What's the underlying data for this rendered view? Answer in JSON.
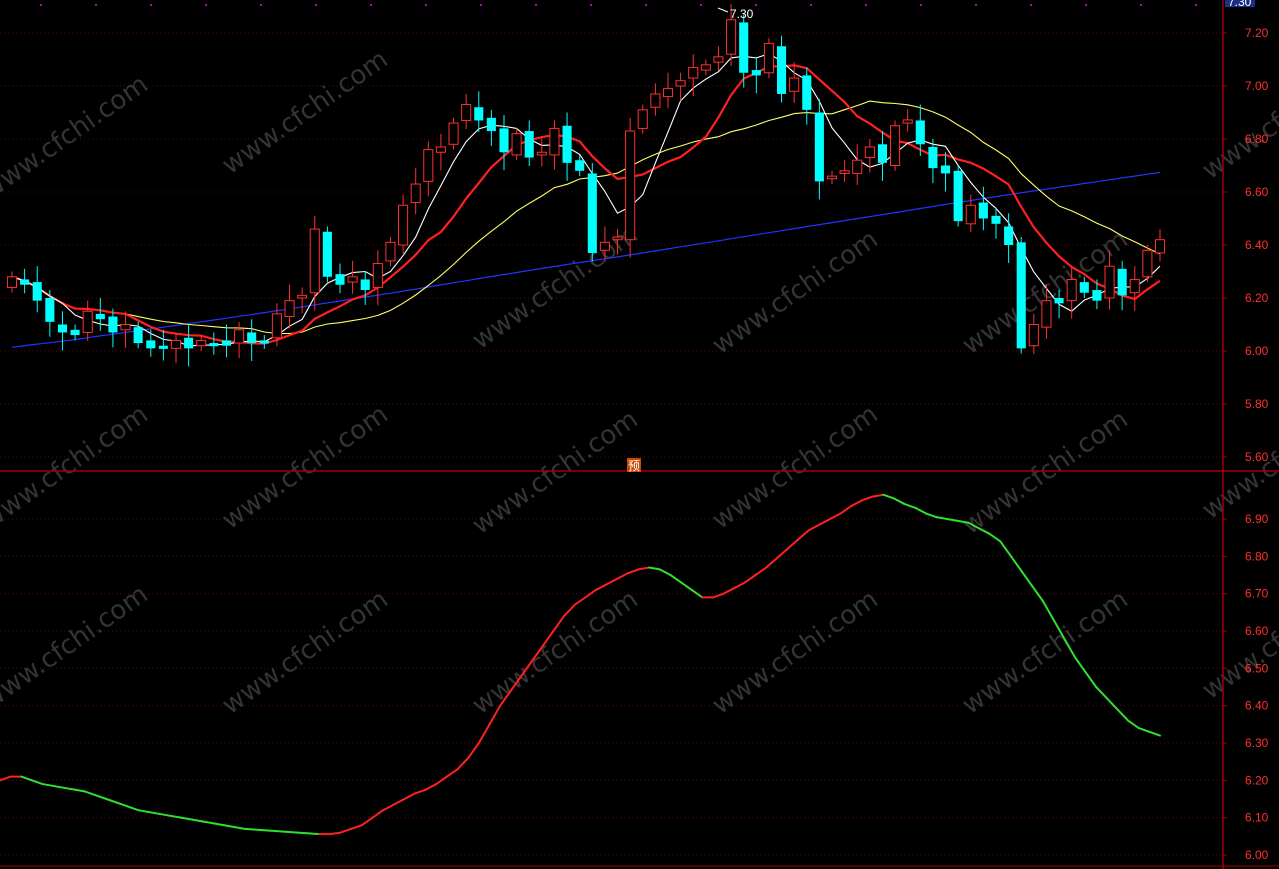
{
  "colors": {
    "background": "#000000",
    "frame": "#a00000",
    "grid": "#700000",
    "axis_text": "#ff3030",
    "candle_up": "#ff3030",
    "candle_down": "#00ffff",
    "ma_fast": "#ffffff",
    "ma_mid": "#ff2020",
    "ma_slow": "#ffff66",
    "ma_long": "#2233ff",
    "ind_up": "#ff2020",
    "ind_down": "#30e030",
    "top_label_bg": "#1a2f8a",
    "badge_bg": "#c84a00",
    "watermark": "#343434"
  },
  "watermark_text": "www.cfchi.com",
  "top_price_label": "7.30",
  "high_marker_label": "7.30",
  "prediction_badge": "预",
  "chart_data": [
    {
      "type": "candlestick",
      "panel": "price",
      "ylim": [
        5.55,
        7.3
      ],
      "y_ticks": [
        "7.20",
        "7.00",
        "6.80",
        "6.60",
        "6.40",
        "6.20",
        "6.00",
        "5.80",
        "5.60"
      ],
      "grid": true,
      "x": [
        1,
        2,
        3,
        4,
        5,
        6,
        7,
        8,
        9,
        10,
        11,
        12,
        13,
        14,
        15,
        16,
        17,
        18,
        19,
        20,
        21,
        22,
        23,
        24,
        25,
        26,
        27,
        28,
        29,
        30,
        31,
        32,
        33,
        34,
        35,
        36,
        37,
        38,
        39,
        40,
        41,
        42,
        43,
        44,
        45,
        46,
        47,
        48,
        49,
        50,
        51,
        52,
        53,
        54,
        55,
        56,
        57,
        58,
        59,
        60,
        61,
        62,
        63,
        64,
        65,
        66,
        67,
        68,
        69,
        70,
        71,
        72,
        73,
        74,
        75,
        76,
        77,
        78,
        79,
        80,
        81,
        82,
        83,
        84,
        85,
        86,
        87,
        88,
        89,
        90,
        91,
        92,
        93,
        94,
        95,
        96,
        97,
        98,
        99,
        100,
        101,
        102,
        103,
        104,
        105,
        106
      ],
      "open": [
        6.24,
        6.27,
        6.26,
        6.2,
        6.1,
        6.08,
        6.07,
        6.14,
        6.13,
        6.08,
        6.09,
        6.04,
        6.02,
        6.01,
        6.05,
        6.02,
        6.03,
        6.04,
        6.03,
        6.07,
        6.04,
        6.05,
        6.13,
        6.2,
        6.22,
        6.45,
        6.29,
        6.26,
        6.27,
        6.24,
        6.34,
        6.4,
        6.56,
        6.64,
        6.75,
        6.78,
        6.87,
        6.92,
        6.88,
        6.84,
        6.74,
        6.83,
        6.74,
        6.74,
        6.85,
        6.72,
        6.67,
        6.38,
        6.42,
        6.42,
        6.84,
        6.92,
        6.96,
        7.0,
        7.03,
        7.06,
        7.09,
        7.12,
        7.24,
        7.06,
        7.05,
        7.15,
        6.98,
        7.04,
        6.9,
        6.65,
        6.67,
        6.67,
        6.73,
        6.78,
        6.7,
        6.86,
        6.87,
        6.77,
        6.7,
        6.68,
        6.48,
        6.56,
        6.51,
        6.47,
        6.41,
        6.02,
        6.09,
        6.2,
        6.19,
        6.26,
        6.23,
        6.2,
        6.31,
        6.22,
        6.28,
        6.37
      ]
    },
    {
      "type": "line",
      "panel": "indicator",
      "ylim": [
        5.98,
        6.99
      ],
      "y_ticks": [
        "6.90",
        "6.80",
        "6.70",
        "6.60",
        "6.50",
        "6.40",
        "6.30",
        "6.20",
        "6.10",
        "6.00"
      ],
      "grid": true,
      "x": [
        0,
        1,
        2,
        3,
        4,
        5,
        6,
        7,
        8,
        9,
        10,
        11,
        12,
        13,
        14,
        15,
        16,
        17,
        18,
        19,
        20,
        21,
        22,
        23,
        24,
        25,
        26,
        27,
        28,
        29,
        30,
        31,
        32,
        33,
        34,
        35,
        36,
        37,
        38,
        39,
        40,
        41,
        42,
        43,
        44,
        45,
        46,
        47,
        48,
        49,
        50,
        51,
        52,
        53,
        54,
        55,
        56,
        57,
        58,
        59,
        60,
        61,
        62,
        63,
        64,
        65,
        66,
        67,
        68,
        69,
        70,
        71,
        72,
        73,
        74,
        75,
        76,
        77,
        78,
        79,
        80,
        81,
        82,
        83,
        84,
        85,
        86,
        87,
        88,
        89,
        90,
        91,
        92,
        93,
        94,
        95,
        96
      ],
      "values": [
        6.2,
        6.21,
        6.21,
        6.2,
        6.19,
        6.185,
        6.18,
        6.175,
        6.17,
        6.16,
        6.15,
        6.14,
        6.13,
        6.12,
        6.115,
        6.11,
        6.105,
        6.1,
        6.095,
        6.09,
        6.085,
        6.08,
        6.075,
        6.07,
        6.068,
        6.066,
        6.064,
        6.062,
        6.06,
        6.058,
        6.056,
        6.056,
        6.06,
        6.07,
        6.08,
        6.1,
        6.12,
        6.135,
        6.15,
        6.165,
        6.175,
        6.19,
        6.21,
        6.23,
        6.26,
        6.3,
        6.35,
        6.4,
        6.44,
        6.48,
        6.52,
        6.56,
        6.6,
        6.64,
        6.67,
        6.69,
        6.71,
        6.725,
        6.74,
        6.755,
        6.765,
        6.77,
        6.765,
        6.75,
        6.73,
        6.71,
        6.69,
        6.69,
        6.7,
        6.715,
        6.73,
        6.75,
        6.77,
        6.795,
        6.82,
        6.845,
        6.87,
        6.885,
        6.9,
        6.915,
        6.935,
        6.95,
        6.96,
        6.965,
        6.955,
        6.94,
        6.93,
        6.915,
        6.905,
        6.9,
        6.895,
        6.89,
        6.875,
        6.86,
        6.84,
        6.8,
        6.76,
        6.72,
        6.68,
        6.63,
        6.58,
        6.53,
        6.49,
        6.45,
        6.42,
        6.39,
        6.36,
        6.34,
        6.33,
        6.32
      ],
      "segment_colors": [
        "up",
        "down",
        "up",
        "down",
        "up",
        "down"
      ]
    }
  ]
}
